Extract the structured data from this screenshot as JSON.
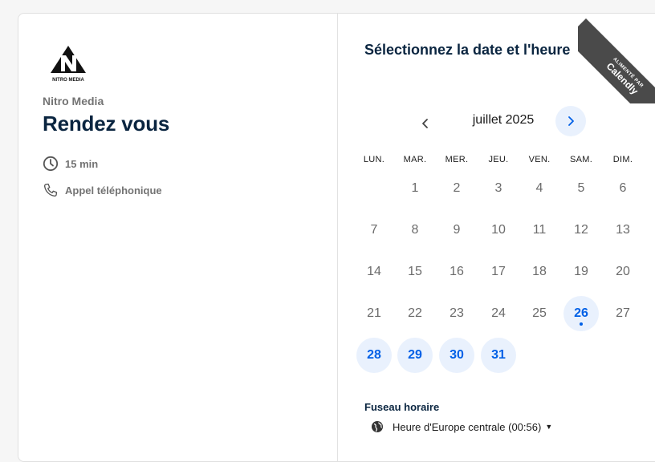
{
  "event": {
    "organization": "Nitro Media",
    "title": "Rendez vous",
    "logo_text": "NITRO MEDIA",
    "duration": "15 min",
    "location": "Appel téléphonique"
  },
  "scheduler": {
    "heading": "Sélectionnez la date et l'heure",
    "month_label": "juillet 2025",
    "weekdays": [
      "LUN.",
      "MAR.",
      "MER.",
      "JEU.",
      "VEN.",
      "SAM.",
      "DIM."
    ],
    "weeks": [
      [
        null,
        "1",
        "2",
        "3",
        "4",
        "5",
        "6"
      ],
      [
        "7",
        "8",
        "9",
        "10",
        "11",
        "12",
        "13"
      ],
      [
        "14",
        "15",
        "16",
        "17",
        "18",
        "19",
        "20"
      ],
      [
        "21",
        "22",
        "23",
        "24",
        "25",
        "26",
        "27"
      ],
      [
        "28",
        "29",
        "30",
        "31",
        null,
        null,
        null
      ]
    ],
    "available_days": [
      "26",
      "28",
      "29",
      "30",
      "31"
    ],
    "today": "26",
    "timezone_label": "Fuseau horaire",
    "timezone_value": "Heure d'Europe centrale (00:56)"
  },
  "badge": {
    "line1": "ALIMENTÉ PAR",
    "line2": "Calendly"
  },
  "icons": {
    "clock": "clock-icon",
    "phone": "phone-icon",
    "prev": "chevron-left-icon",
    "next": "chevron-right-icon",
    "globe": "globe-icon",
    "caret": "caret-down-icon"
  },
  "colors": {
    "accent": "#0060e6",
    "accent_bg": "#e9f1fd",
    "heading": "#0a2540",
    "muted": "#737373",
    "ribbon": "#4a4a4a"
  }
}
